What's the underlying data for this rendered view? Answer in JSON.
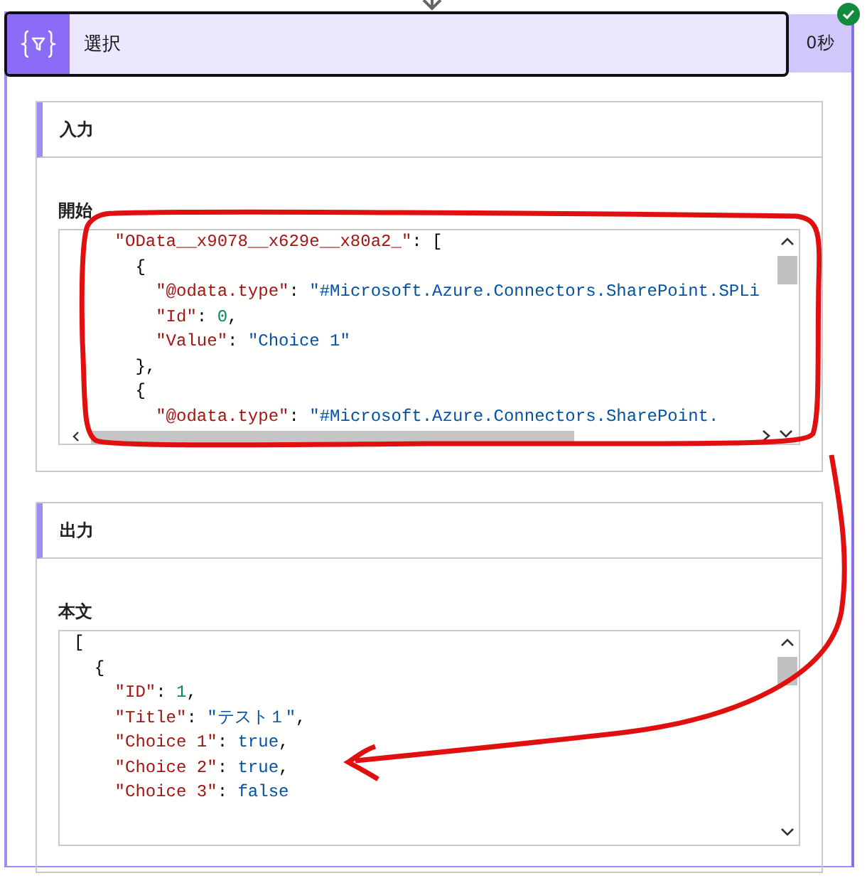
{
  "action": {
    "title": "選択",
    "duration": "0秒",
    "succeeded": true
  },
  "sections": [
    {
      "title": "入力",
      "field_label": "開始",
      "lines": [
        [
          {
            "kind": "key",
            "text": "    \"OData__x9078__x629e__x80a2_\""
          },
          {
            "kind": "punct",
            "text": ": ["
          }
        ],
        [
          {
            "kind": "punct",
            "text": "      {"
          }
        ],
        [
          {
            "kind": "key",
            "text": "        \"@odata.type\""
          },
          {
            "kind": "punct",
            "text": ": "
          },
          {
            "kind": "str",
            "text": "\"#Microsoft.Azure.Connectors.SharePoint.SPLi"
          }
        ],
        [
          {
            "kind": "key",
            "text": "        \"Id\""
          },
          {
            "kind": "punct",
            "text": ": "
          },
          {
            "kind": "num",
            "text": "0"
          },
          {
            "kind": "punct",
            "text": ","
          }
        ],
        [
          {
            "kind": "key",
            "text": "        \"Value\""
          },
          {
            "kind": "punct",
            "text": ": "
          },
          {
            "kind": "str",
            "text": "\"Choice 1\""
          }
        ],
        [
          {
            "kind": "punct",
            "text": "      },"
          }
        ],
        [
          {
            "kind": "punct",
            "text": "      {"
          }
        ],
        [
          {
            "kind": "key",
            "text": "        \"@odata.type\""
          },
          {
            "kind": "punct",
            "text": ": "
          },
          {
            "kind": "str",
            "text": "\"#Microsoft.Azure.Connectors.SharePoint."
          }
        ]
      ],
      "horizontal_scroll": true
    },
    {
      "title": "出力",
      "field_label": "本文",
      "lines": [
        [
          {
            "kind": "punct",
            "text": "["
          }
        ],
        [
          {
            "kind": "punct",
            "text": "  {"
          }
        ],
        [
          {
            "kind": "key",
            "text": "    \"ID\""
          },
          {
            "kind": "punct",
            "text": ": "
          },
          {
            "kind": "num",
            "text": "1"
          },
          {
            "kind": "punct",
            "text": ","
          }
        ],
        [
          {
            "kind": "key",
            "text": "    \"Title\""
          },
          {
            "kind": "punct",
            "text": ": "
          },
          {
            "kind": "str",
            "text": "\"テスト１\""
          },
          {
            "kind": "punct",
            "text": ","
          }
        ],
        [
          {
            "kind": "key",
            "text": "    \"Choice 1\""
          },
          {
            "kind": "punct",
            "text": ": "
          },
          {
            "kind": "bool",
            "text": "true"
          },
          {
            "kind": "punct",
            "text": ","
          }
        ],
        [
          {
            "kind": "key",
            "text": "    \"Choice 2\""
          },
          {
            "kind": "punct",
            "text": ": "
          },
          {
            "kind": "bool",
            "text": "true"
          },
          {
            "kind": "punct",
            "text": ","
          }
        ],
        [
          {
            "kind": "key",
            "text": "    \"Choice 3\""
          },
          {
            "kind": "punct",
            "text": ": "
          },
          {
            "kind": "bool",
            "text": "false"
          }
        ]
      ],
      "horizontal_scroll": false
    }
  ]
}
